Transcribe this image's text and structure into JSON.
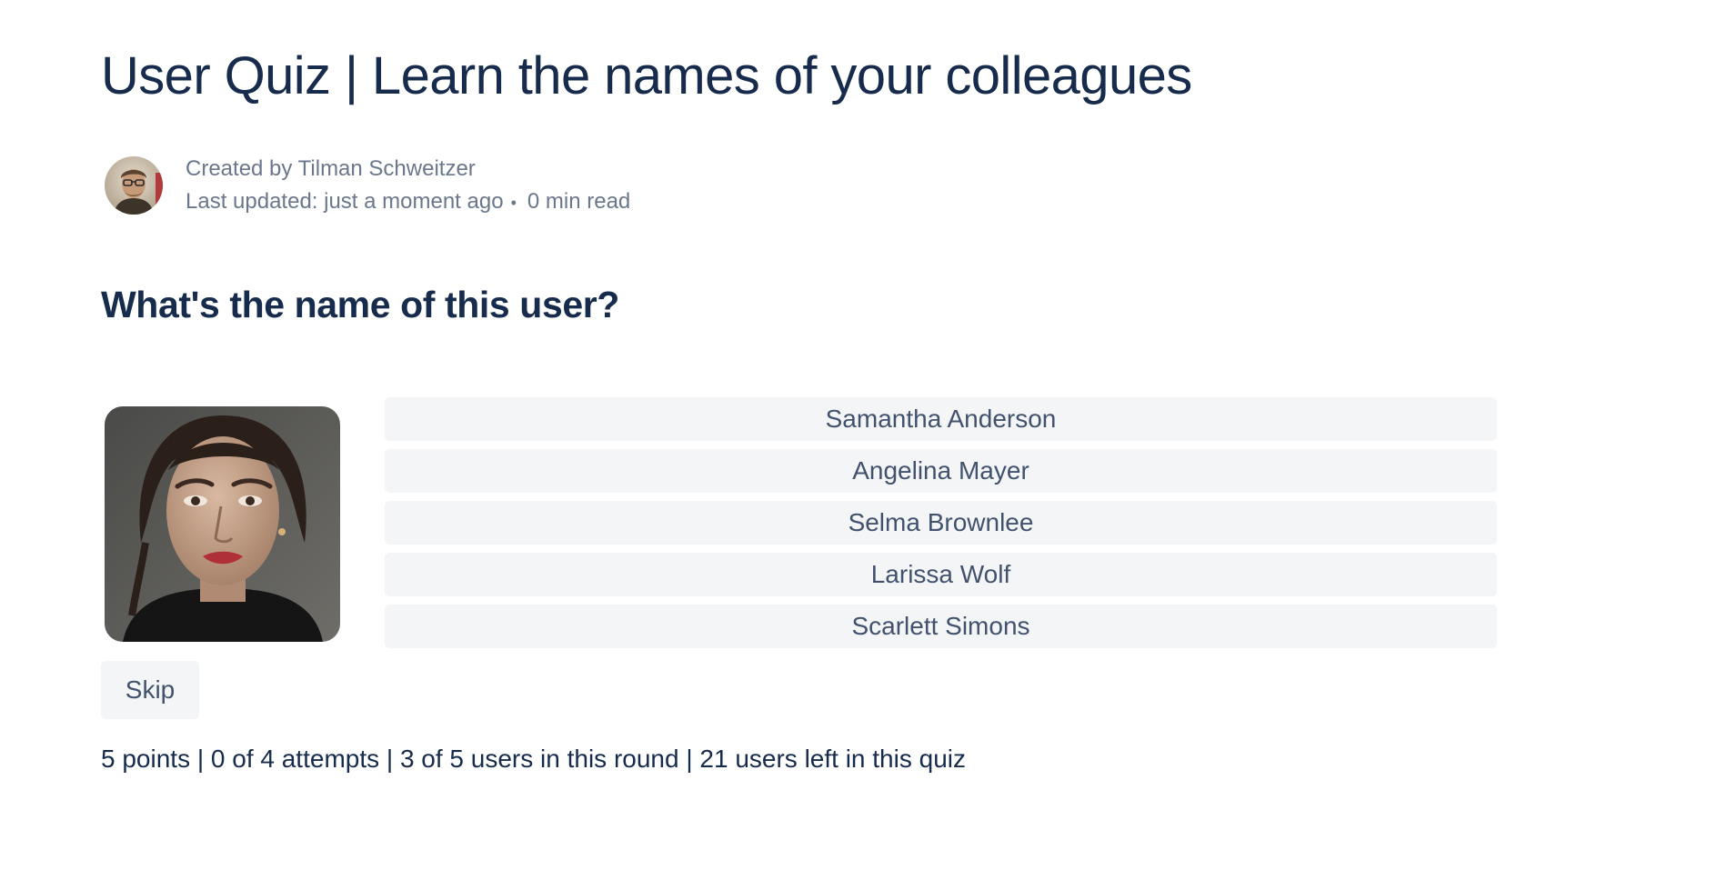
{
  "page": {
    "title": "User Quiz | Learn the names of your colleagues"
  },
  "byline": {
    "created_by": "Created by Tilman Schweitzer",
    "last_updated": "Last updated: just a moment ago",
    "separator": "•",
    "read_time": "0 min read"
  },
  "quiz": {
    "question": "What's the name of this user?",
    "answers": [
      {
        "label": "Samantha Anderson"
      },
      {
        "label": "Angelina Mayer"
      },
      {
        "label": "Selma Brownlee"
      },
      {
        "label": "Larissa Wolf"
      },
      {
        "label": "Scarlett Simons"
      }
    ],
    "skip_label": "Skip",
    "stats": "5 points | 0 of 4 attempts | 3 of 5 users in this round | 21 users left in this quiz"
  },
  "colors": {
    "heading": "#172b4d",
    "muted_text": "#6b778c",
    "button_bg": "#f4f5f7",
    "button_text": "#42526e"
  }
}
